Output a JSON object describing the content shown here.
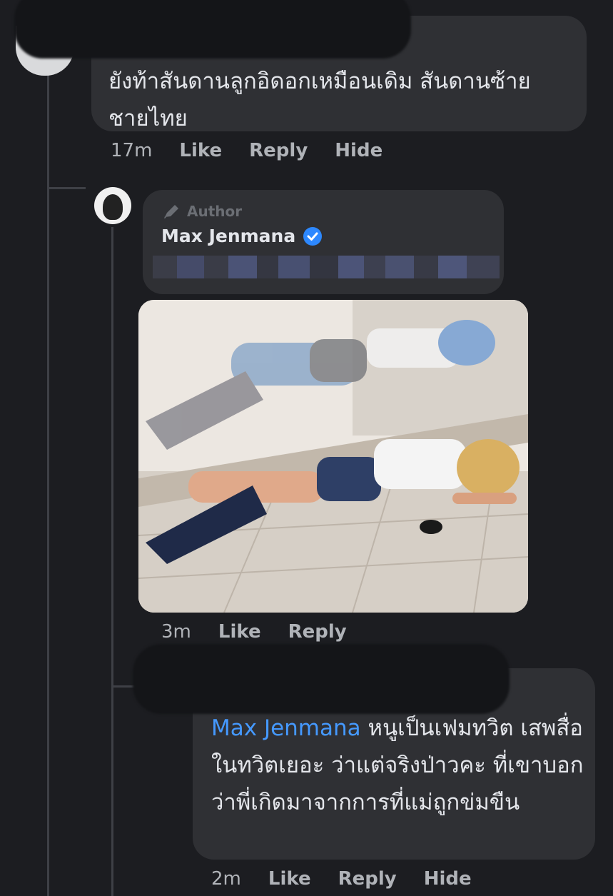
{
  "comment1": {
    "text": "ยังท้าสันดานลูกอิดอกเหมือนเดิม สันดานซ้าย ชายไทย",
    "time": "17m",
    "actions": [
      "Like",
      "Reply",
      "Hide"
    ]
  },
  "reply1": {
    "badge": "Author",
    "author": "Max Jenmana",
    "verified": true,
    "image_alt": "photo-meme",
    "time": "3m",
    "actions": [
      "Like",
      "Reply"
    ]
  },
  "reply2": {
    "mention": "Max Jenmana",
    "text": "หนูเป็นเฟมทวิต เสพสื่อในทวิตเยอะ ว่าแต่จริงป่าวคะ ที่เขาบอกว่าพี่เกิดมาจากการที่แม่ถูกข่มขืน",
    "time": "2m",
    "actions": [
      "Like",
      "Reply",
      "Hide"
    ]
  },
  "colors": {
    "background": "#1c1d21",
    "bubble": "#2f3034",
    "mention": "#4599ff",
    "verified": "#2d88ff",
    "meta": "#b0b3b8"
  }
}
